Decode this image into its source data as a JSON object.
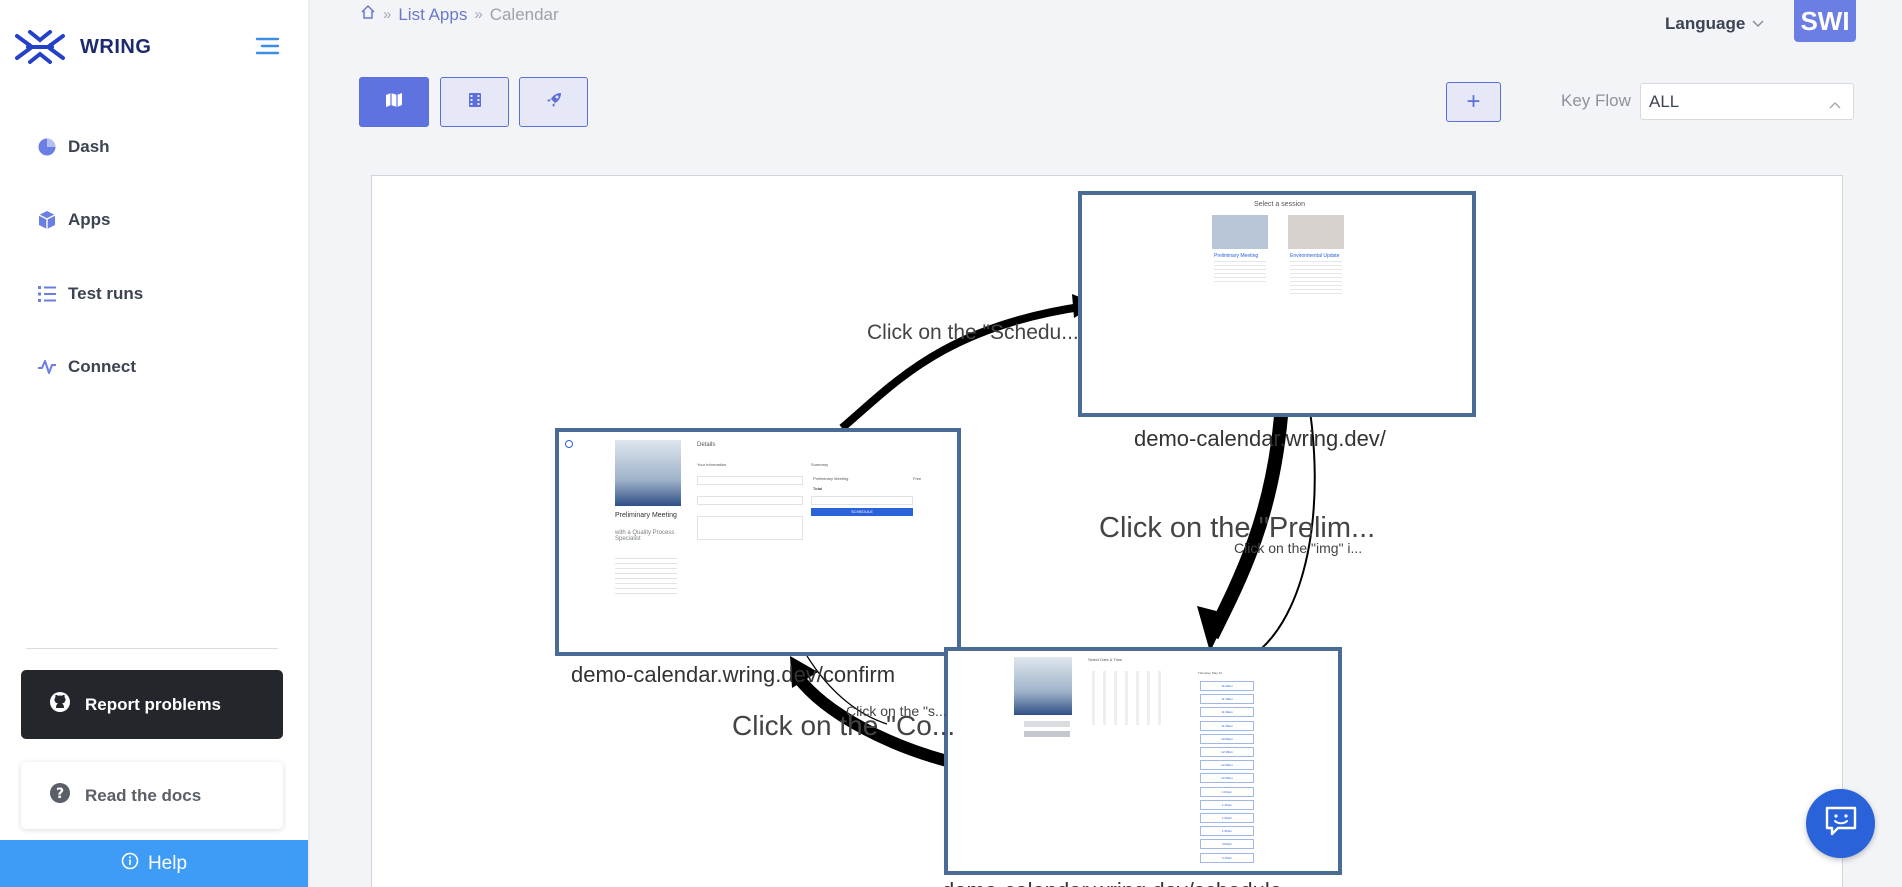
{
  "app": {
    "logo_text": "WRING"
  },
  "sidebar": {
    "items": [
      {
        "label": "Dash",
        "icon": "pie-chart-icon"
      },
      {
        "label": "Apps",
        "icon": "cube-icon"
      },
      {
        "label": "Test runs",
        "icon": "list-icon"
      },
      {
        "label": "Connect",
        "icon": "activity-icon"
      }
    ],
    "report_label": "Report problems",
    "docs_label": "Read the docs",
    "help_label": "Help"
  },
  "breadcrumb": {
    "items": [
      "List Apps",
      "Calendar"
    ]
  },
  "header": {
    "language_label": "Language",
    "avatar_text": "SWI"
  },
  "toolbar": {
    "view_buttons": [
      "map-icon",
      "film-icon",
      "rocket-icon"
    ],
    "active_view": "map-icon",
    "add_label": "+",
    "keyflow_label": "Key Flow",
    "keyflow_value": "ALL"
  },
  "graph": {
    "nodes": [
      {
        "label": "demo-calendar.wring.dev/"
      },
      {
        "label": "demo-calendar.wring.dev/confirm"
      },
      {
        "label": "demo-calendar.wring.dev/schedule"
      }
    ],
    "edges": [
      {
        "label": "Click on the \"Schedu..."
      },
      {
        "label": "Click on the \"Prelim..."
      },
      {
        "label": "Click on the \"img\" i..."
      },
      {
        "label": "Click on the \"Co..."
      },
      {
        "label": "Click on the \"s..."
      }
    ],
    "thumb_home": {
      "title": "Select a session",
      "card1_title": "Preliminary Meeting",
      "card2_title": "Environmental Update"
    },
    "thumb_confirm": {
      "details": "Details",
      "meeting_title": "Preliminary Meeting",
      "meeting_sub": "with a Quality Process Specialist",
      "your_info": "Your Information",
      "summary": "Summary",
      "summary_item": "Preliminary Meeting",
      "total": "Total",
      "price": "Free",
      "schedule_btn": "SCHEDULE"
    },
    "thumb_schedule": {
      "title": "Select Date & Time",
      "day_header": "Thursday, May 23",
      "slots": [
        "11:00am",
        "11:15am",
        "11:30am",
        "11:45am",
        "12:00pm",
        "12:15pm",
        "12:30pm",
        "12:45pm",
        "1:00pm",
        "1:15pm",
        "1:30pm",
        "1:45pm",
        "2:00pm",
        "2:15pm"
      ]
    }
  }
}
